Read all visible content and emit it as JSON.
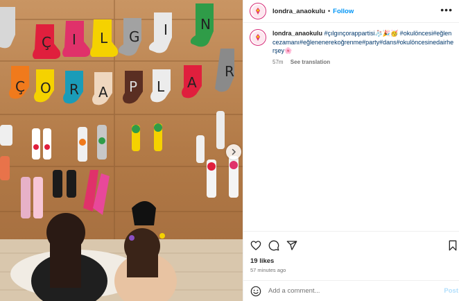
{
  "post": {
    "username": "londra_anaokulu",
    "follow_label": "Follow",
    "more_label": "•••",
    "caption": {
      "username": "londra_anaokulu",
      "text": "#çılgınçorappartisi🧦🎉🥳 #okulöncesi#eğlencezamanı#eğlenenerekoğrenme#party#dans#okulöncesinedairherşey🌸",
      "time": "57m",
      "translate_label": "See translation"
    },
    "likes": "19 likes",
    "ago": "57 minutes ago",
    "comment": {
      "placeholder": "Add a comment...",
      "post_label": "Post"
    }
  },
  "photo": {
    "letters_row1": [
      "Ç",
      "I",
      "L",
      "G",
      "I",
      "N"
    ],
    "letters_row2": [
      "Ç",
      "O",
      "R",
      "A",
      "P",
      "L",
      "A",
      "R"
    ]
  },
  "colors": {
    "link_blue": "#0095f6",
    "hashtag_blue": "#00376b",
    "wood": "#b98452",
    "avatar_ring": "#d62976"
  },
  "icons": [
    "more-icon",
    "heart-icon",
    "comment-icon",
    "share-icon",
    "save-icon",
    "emoji-icon",
    "carousel-next-icon"
  ]
}
